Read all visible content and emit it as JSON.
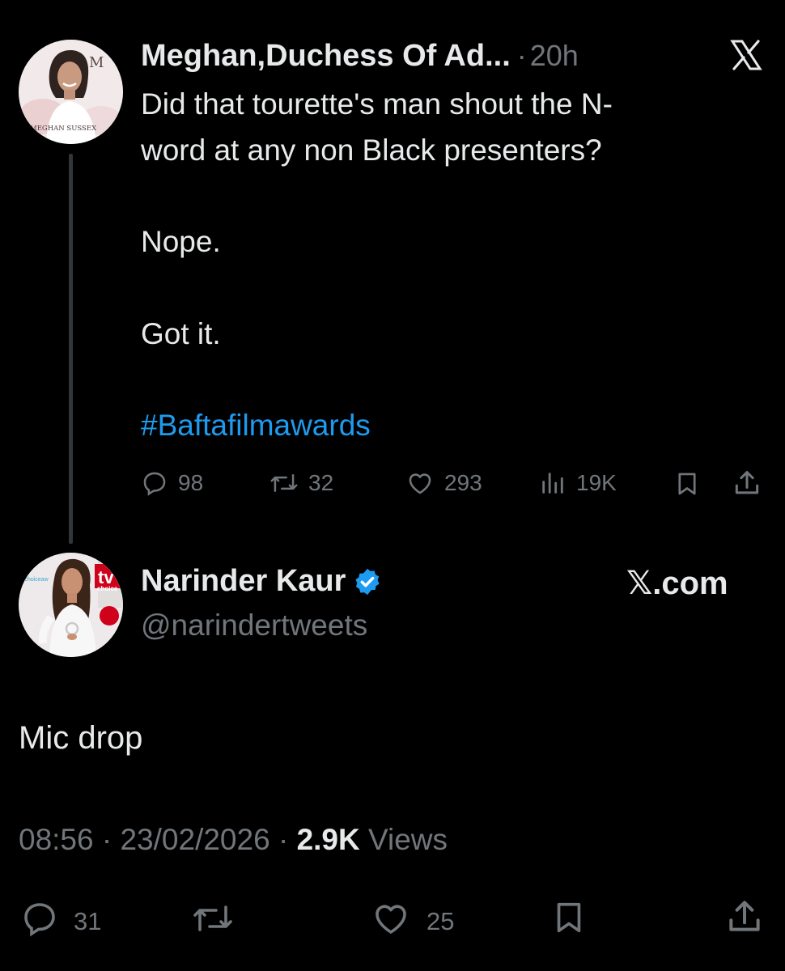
{
  "parent_tweet": {
    "author_name": "Meghan,Duchess Of Ad...",
    "separator": "·",
    "time": "20h",
    "avatar_text": {
      "monogram": "M",
      "caption": "MEGHAN SUSSEX"
    },
    "lines": [
      "Did that tourette's man shout the N-",
      "word at any non Black presenters?",
      "Nope.",
      "Got it."
    ],
    "hashtag": "#Baftafilmawards",
    "actions": {
      "replies": "98",
      "reposts": "32",
      "likes": "293",
      "views": "19K"
    }
  },
  "main_tweet": {
    "author_name": "Narinder Kaur",
    "handle": "@narindertweets",
    "verified": true,
    "source_label": "𝕏.com",
    "avatar_text": {
      "badge": "tv",
      "badge_sub": "choice",
      "backdrop": "tvchoiceaw"
    },
    "text": "Mic drop",
    "meta": {
      "time": "08:56",
      "dot1": "·",
      "date": "23/02/2026",
      "dot2": "·",
      "views_count": "2.9K",
      "views_label": "Views"
    },
    "actions": {
      "replies": "31",
      "likes": "25"
    }
  },
  "colors": {
    "background": "#000000",
    "text": "#e7e9ea",
    "muted": "#71767b",
    "link": "#1d9bf0",
    "verified": "#1d9bf0",
    "thread_line": "#333639"
  }
}
